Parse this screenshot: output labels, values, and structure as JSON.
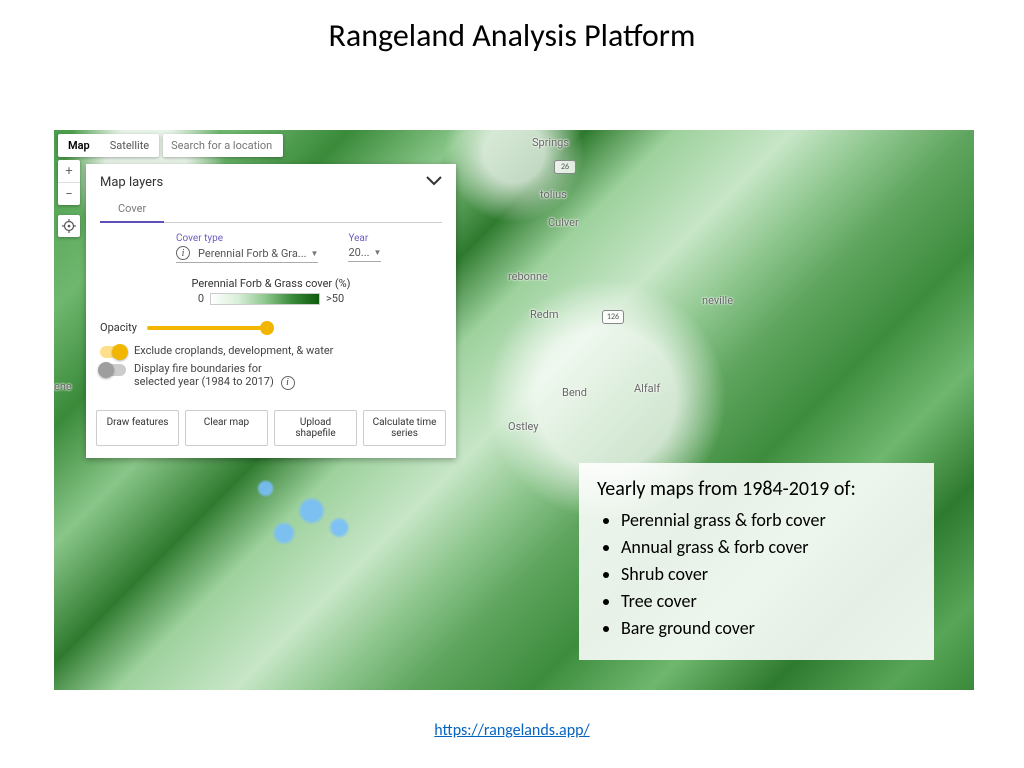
{
  "title": "Rangeland Analysis Platform",
  "map_type": {
    "map": "Map",
    "satellite": "Satellite"
  },
  "search": {
    "placeholder": "Search for a location"
  },
  "panel": {
    "title": "Map layers",
    "tab": "Cover",
    "cover_type_label": "Cover type",
    "cover_type_value": "Perennial Forb & Gra...",
    "year_label": "Year",
    "year_value": "20...",
    "legend_title": "Perennial Forb & Grass cover (%)",
    "legend_min": "0",
    "legend_max": ">50",
    "opacity_label": "Opacity",
    "toggle_exclude": "Exclude croplands, development, & water",
    "toggle_fire_line1": "Display fire boundaries for",
    "toggle_fire_line2": "selected year (1984 to 2017)",
    "buttons": {
      "draw": "Draw features",
      "clear": "Clear map",
      "upload": "Upload shapefile",
      "calc": "Calculate time series"
    }
  },
  "map_labels": {
    "bend": "Bend",
    "redm": "Redm",
    "culver": "Culver",
    "springs": "Springs",
    "terrebonne": "rebonne",
    "prine": "neville",
    "metolius": "tolius",
    "alf": "Alfalf",
    "ost": "Ostley",
    "ene": "ene"
  },
  "route_badges": {
    "r26": "26",
    "r126": "126"
  },
  "info_box": {
    "heading": "Yearly maps from 1984-2019 of:",
    "items": [
      "Perennial grass & forb cover",
      "Annual grass & forb cover",
      "Shrub cover",
      "Tree cover",
      "Bare ground cover"
    ]
  },
  "footer_url": "https://rangelands.app/"
}
